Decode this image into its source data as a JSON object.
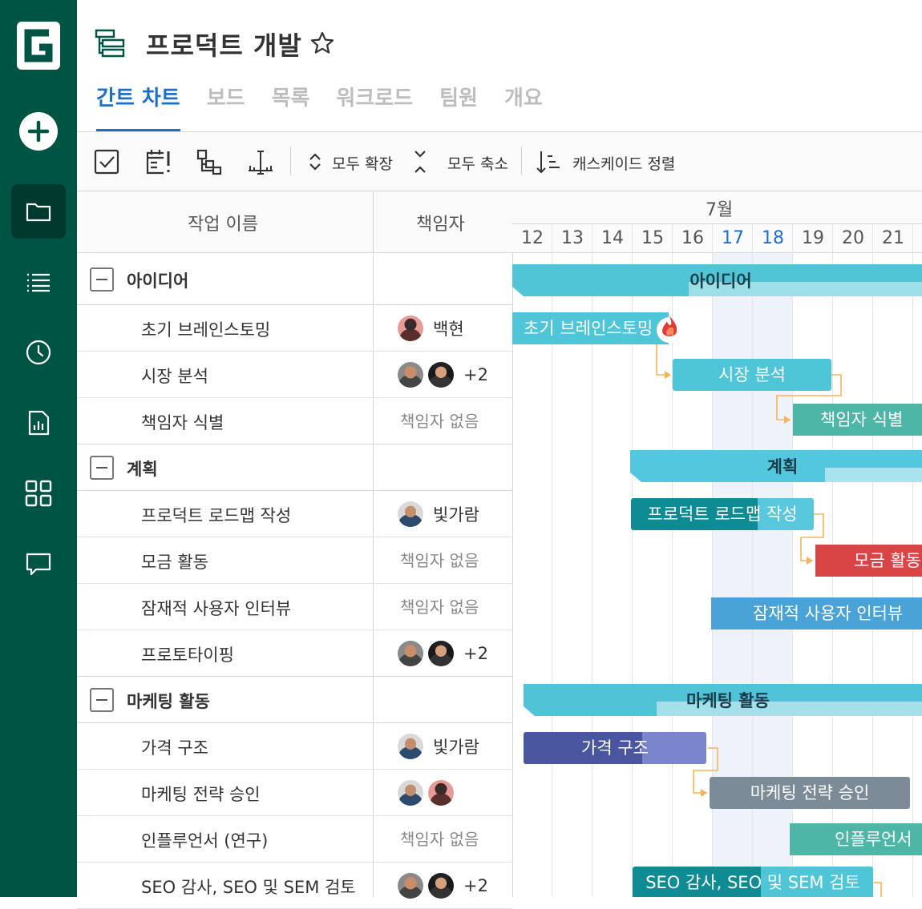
{
  "project": {
    "title": "프로덕트 개발"
  },
  "tabs": [
    "간트 차트",
    "보드",
    "목록",
    "워크로드",
    "팀원",
    "개요"
  ],
  "toolbar": {
    "expand_all": "모두 확장",
    "collapse_all": "모두 축소",
    "cascade_sort": "캐스케이드 정렬"
  },
  "headers": {
    "task_name": "작업 이름",
    "owner": "책임자",
    "month": "7월"
  },
  "days": [
    "12",
    "13",
    "14",
    "15",
    "16",
    "17",
    "18",
    "19",
    "20",
    "21"
  ],
  "groups": [
    {
      "name": "아이디어",
      "tasks": [
        {
          "name": "초기 브레인스토밍",
          "owner": "백현"
        },
        {
          "name": "시장 분석",
          "owner": "+2"
        },
        {
          "name": "책임자 식별",
          "owner": "책임자 없음"
        }
      ]
    },
    {
      "name": "계획",
      "tasks": [
        {
          "name": "프로덕트 로드맵 작성",
          "owner": "빛가람"
        },
        {
          "name": "모금 활동",
          "owner": "책임자 없음"
        },
        {
          "name": "잠재적 사용자 인터뷰",
          "owner": "책임자 없음"
        },
        {
          "name": "프로토타이핑",
          "owner": "+2"
        }
      ]
    },
    {
      "name": "마케팅 활동",
      "tasks": [
        {
          "name": "가격 구조",
          "owner": "빛가람"
        },
        {
          "name": "마케팅 전략 승인",
          "owner": ""
        },
        {
          "name": "인플루언서 (연구)",
          "owner": "책임자 없음"
        },
        {
          "name": "SEO 감사, SEO 및 SEM 검토",
          "owner": "+2"
        }
      ]
    }
  ],
  "bars": {
    "g1": "아이디어",
    "t1": "초기 브레인스토밍",
    "t2": "시장 분석",
    "t3": "책임자 식별",
    "g2": "계획",
    "t4": "프로덕트 로드맵 작성",
    "t5": "모금 활동",
    "t6": "잠재적 사용자 인터뷰",
    "g3": "마케팅 활동",
    "t8": "가격 구조",
    "t9": "마케팅 전략 승인",
    "t10": "인플루언서",
    "t11": "SEO 감사, SEO 및 SEM 검토"
  },
  "colors": {
    "sidebar": "#005444",
    "accent": "#1e6fc7",
    "idea": "#4fc6d8",
    "plan": "#57c3de",
    "red": "#d94545",
    "purple": "#5560a8",
    "gray": "#7b8b97",
    "teal": "#4db6a6",
    "blue": "#4aa3d6"
  }
}
